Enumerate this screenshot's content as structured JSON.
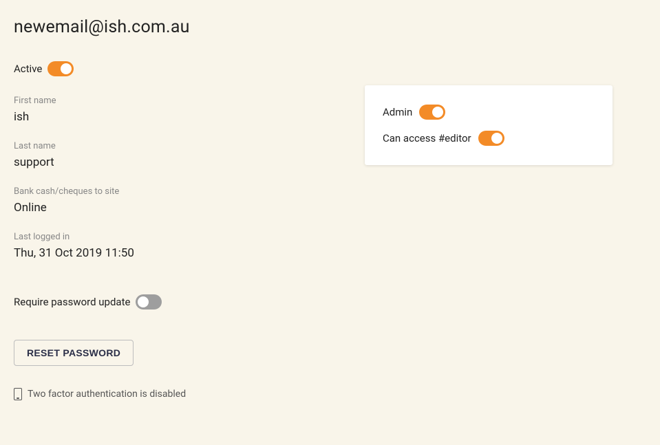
{
  "title": "newemail@ish.com.au",
  "active": {
    "label": "Active",
    "on": true
  },
  "fields": {
    "firstName": {
      "label": "First name",
      "value": "ish"
    },
    "lastName": {
      "label": "Last name",
      "value": "support"
    },
    "bankSite": {
      "label": "Bank cash/cheques to site",
      "value": "Online"
    },
    "lastLogin": {
      "label": "Last logged in",
      "value": "Thu, 31 Oct 2019 11:50"
    }
  },
  "password": {
    "requireUpdate": {
      "label": "Require password update",
      "on": false
    },
    "resetLabel": "RESET PASSWORD"
  },
  "tfa": {
    "text": "Two factor authentication is disabled"
  },
  "perms": {
    "admin": {
      "label": "Admin",
      "on": true
    },
    "editor": {
      "label": "Can access #editor",
      "on": true
    }
  }
}
